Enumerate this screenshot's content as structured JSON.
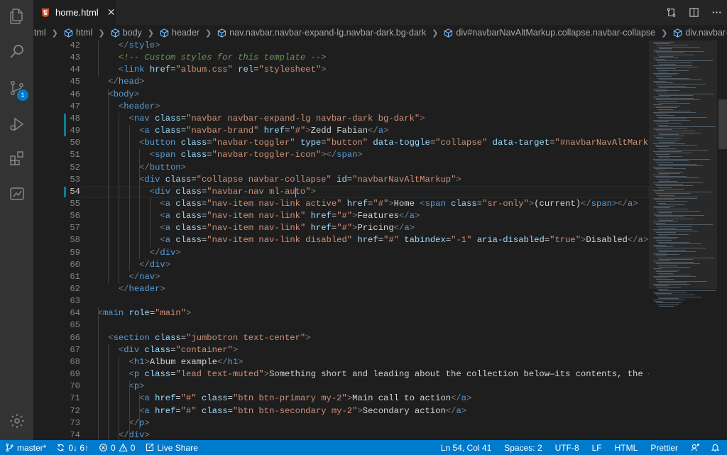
{
  "tab": {
    "filename": "home.html"
  },
  "activity": {
    "scm_badge": "1"
  },
  "breadcrumb": [
    "html",
    "html",
    "body",
    "header",
    "nav.navbar.navbar-expand-lg.navbar-dark.bg-dark",
    "div#navbarNavAltMarkup.collapse.navbar-collapse",
    "div.navbar-nav.ml-a"
  ],
  "code": {
    "lines": [
      {
        "n": "42",
        "t": "      </style>"
      },
      {
        "n": "43",
        "t": "      <!-- Custom styles for this template -->"
      },
      {
        "n": "44",
        "t": "      <link href=\"album.css\" rel=\"stylesheet\">"
      },
      {
        "n": "45",
        "t": "    </head>"
      },
      {
        "n": "46",
        "t": "    <body>"
      },
      {
        "n": "47",
        "t": "      <header>"
      },
      {
        "n": "48",
        "t": "        <nav class=\"navbar navbar-expand-lg navbar-dark bg-dark\">"
      },
      {
        "n": "49",
        "t": "          <a class=\"navbar-brand\" href=\"#\">Zedd Fabian</a>"
      },
      {
        "n": "50",
        "t": "          <button class=\"navbar-toggler\" type=\"button\" data-toggle=\"collapse\" data-target=\"#navbarNavAltMarkup\" aria-co"
      },
      {
        "n": "51",
        "t": "            <span class=\"navbar-toggler-icon\"></span>"
      },
      {
        "n": "52",
        "t": "          </button>"
      },
      {
        "n": "53",
        "t": "          <div class=\"collapse navbar-collapse\" id=\"navbarNavAltMarkup\">"
      },
      {
        "n": "54",
        "t": "            <div class=\"navbar-nav ml-auto\">"
      },
      {
        "n": "55",
        "t": "              <a class=\"nav-item nav-link active\" href=\"#\">Home <span class=\"sr-only\">(current)</span></a>"
      },
      {
        "n": "56",
        "t": "              <a class=\"nav-item nav-link\" href=\"#\">Features</a>"
      },
      {
        "n": "57",
        "t": "              <a class=\"nav-item nav-link\" href=\"#\">Pricing</a>"
      },
      {
        "n": "58",
        "t": "              <a class=\"nav-item nav-link disabled\" href=\"#\" tabindex=\"-1\" aria-disabled=\"true\">Disabled</a>"
      },
      {
        "n": "59",
        "t": "            </div>"
      },
      {
        "n": "60",
        "t": "          </div>"
      },
      {
        "n": "61",
        "t": "        </nav>"
      },
      {
        "n": "62",
        "t": "      </header>"
      },
      {
        "n": "63",
        "t": ""
      },
      {
        "n": "64",
        "t": "  <main role=\"main\">"
      },
      {
        "n": "65",
        "t": ""
      },
      {
        "n": "66",
        "t": "    <section class=\"jumbotron text-center\">"
      },
      {
        "n": "67",
        "t": "      <div class=\"container\">"
      },
      {
        "n": "68",
        "t": "        <h1>Album example</h1>"
      },
      {
        "n": "69",
        "t": "        <p class=\"lead text-muted\">Something short and leading about the collection below—its contents, the creator, et"
      },
      {
        "n": "70",
        "t": "        <p>"
      },
      {
        "n": "71",
        "t": "          <a href=\"#\" class=\"btn btn-primary my-2\">Main call to action</a>"
      },
      {
        "n": "72",
        "t": "          <a href=\"#\" class=\"btn btn-secondary my-2\">Secondary action</a>"
      },
      {
        "n": "73",
        "t": "        </p>"
      },
      {
        "n": "74",
        "t": "      </div>"
      }
    ]
  },
  "status": {
    "branch": "master*",
    "sync": "0↓ 6↑",
    "errors": "0",
    "warnings": "0",
    "live_share": "Live Share",
    "position": "Ln 54, Col 41",
    "spaces": "Spaces: 2",
    "encoding": "UTF-8",
    "eol": "LF",
    "language": "HTML",
    "formatter": "Prettier"
  },
  "colors": {
    "status_bar": "#007acc",
    "editor_bg": "#1e1e1e",
    "activity_bg": "#333333",
    "tag": "#569cd6",
    "attr": "#9cdcfe",
    "string": "#ce9178",
    "comment": "#6a9955"
  }
}
